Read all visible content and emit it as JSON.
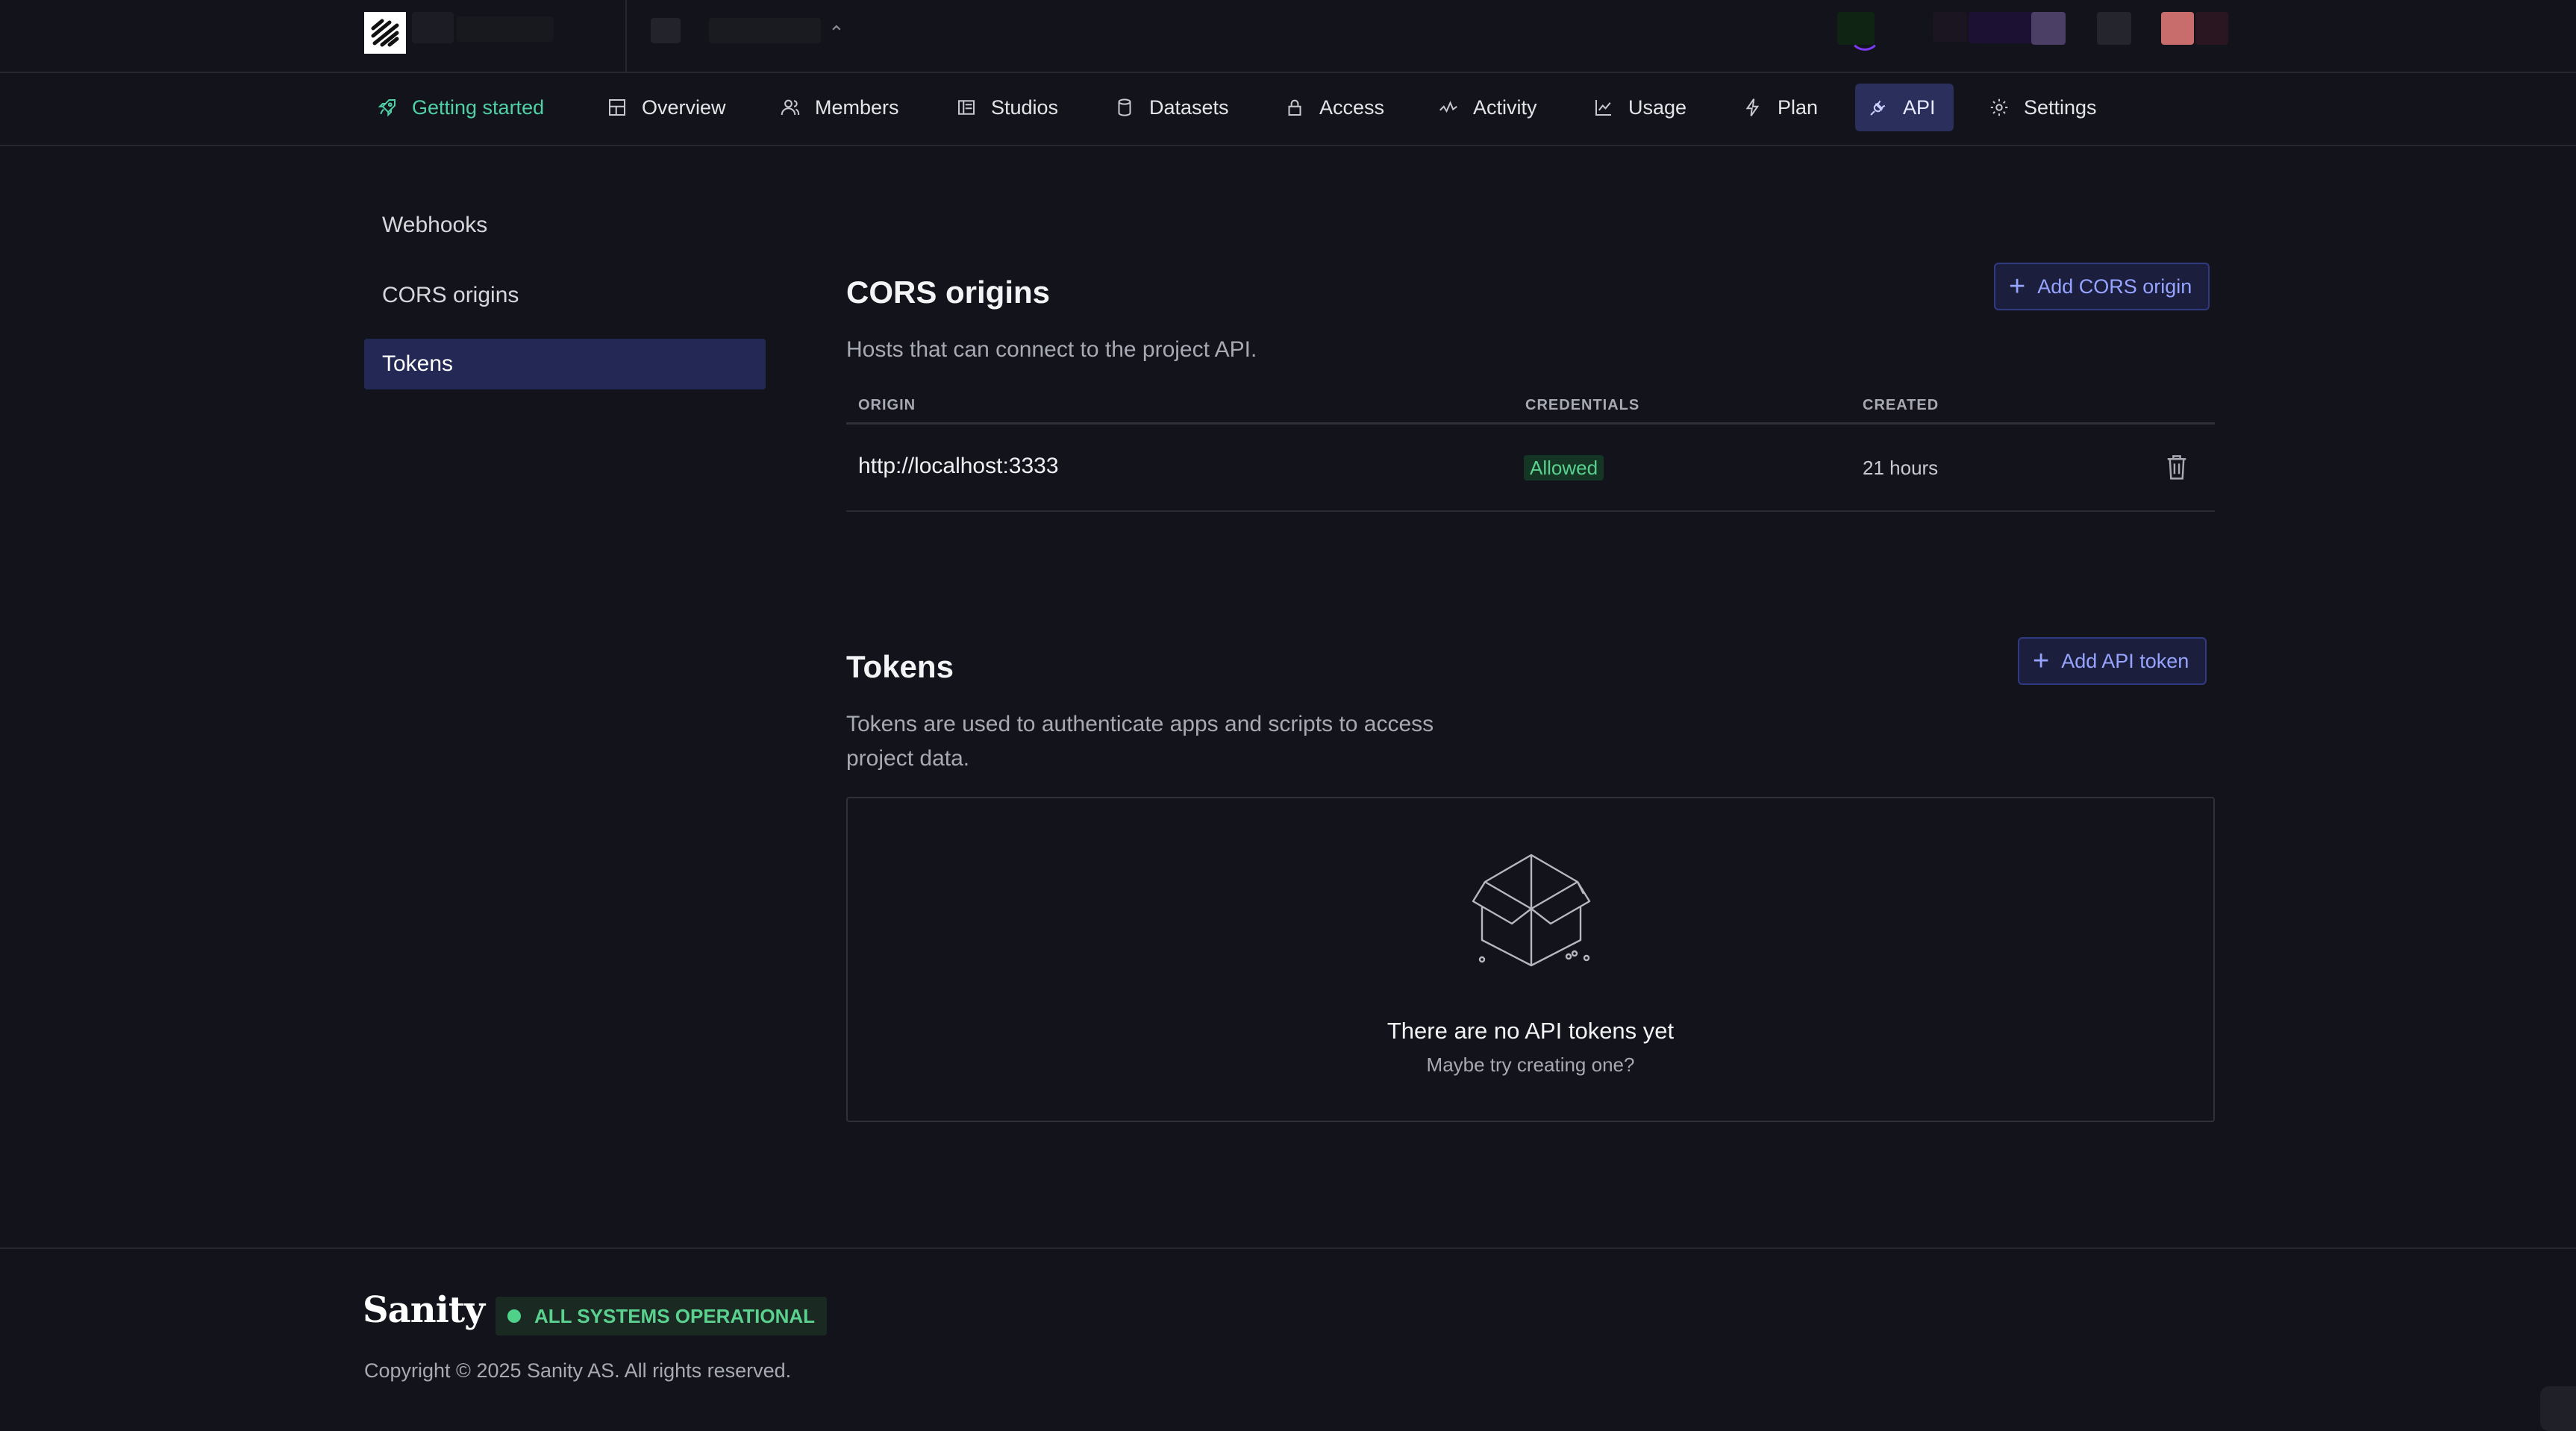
{
  "nav": {
    "items": [
      {
        "label": "Getting started",
        "icon": "rocket-icon"
      },
      {
        "label": "Overview",
        "icon": "layout-icon"
      },
      {
        "label": "Members",
        "icon": "users-icon"
      },
      {
        "label": "Studios",
        "icon": "studio-icon"
      },
      {
        "label": "Datasets",
        "icon": "database-icon"
      },
      {
        "label": "Access",
        "icon": "lock-icon"
      },
      {
        "label": "Activity",
        "icon": "activity-icon"
      },
      {
        "label": "Usage",
        "icon": "chart-icon"
      },
      {
        "label": "Plan",
        "icon": "bolt-icon"
      },
      {
        "label": "API",
        "icon": "plug-icon"
      },
      {
        "label": "Settings",
        "icon": "gear-icon"
      }
    ],
    "active": "API"
  },
  "sidebar": {
    "items": [
      {
        "label": "Webhooks"
      },
      {
        "label": "CORS origins"
      },
      {
        "label": "Tokens"
      }
    ],
    "active": "Tokens"
  },
  "cors": {
    "title": "CORS origins",
    "description": "Hosts that can connect to the project API.",
    "add_button": "Add CORS origin",
    "columns": [
      "ORIGIN",
      "CREDENTIALS",
      "CREATED"
    ],
    "rows": [
      {
        "origin": "http://localhost:3333",
        "credentials": "Allowed",
        "created": "21 hours"
      }
    ]
  },
  "tokens": {
    "title": "Tokens",
    "description_line1": "Tokens are used to authenticate apps and scripts to access",
    "description_line2": "project data.",
    "add_button": "Add API token",
    "empty_title": "There are no API tokens yet",
    "empty_subtitle": "Maybe try creating one?"
  },
  "footer": {
    "brand": "Sanity",
    "status": "ALL SYSTEMS OPERATIONAL",
    "copyright": "Copyright © 2025 Sanity AS. All rights reserved."
  },
  "colors": {
    "background": "#13141b",
    "accent": "#97a4ff",
    "green": "#4fd1a5",
    "active_nav": "#2a2f5c"
  }
}
